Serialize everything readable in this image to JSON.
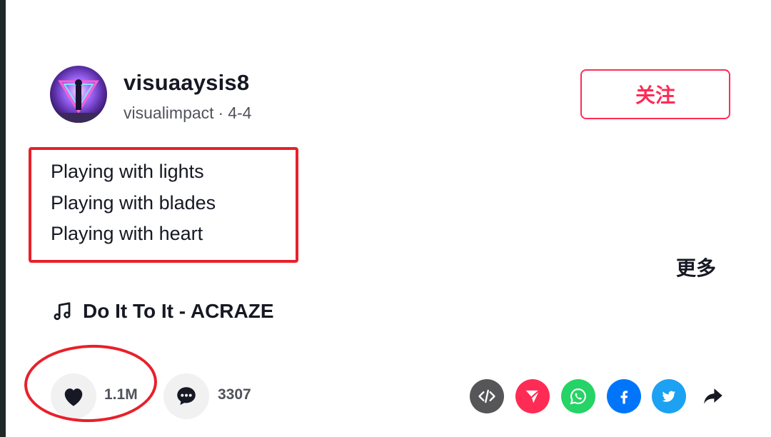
{
  "author": {
    "username": "visuaaysis8",
    "nickname": "visualimpact",
    "separator": "·",
    "date": "4-4"
  },
  "follow_label": "关注",
  "description": {
    "lines": [
      "Playing with lights",
      "Playing with blades",
      "Playing with heart"
    ]
  },
  "more_label": "更多",
  "music": {
    "icon": "music-note-icon",
    "title": "Do It To It - ACRAZE"
  },
  "stats": {
    "likes": "1.1M",
    "comments": "3307"
  },
  "share": {
    "items": [
      {
        "icon": "embed-icon",
        "color": "#565658"
      },
      {
        "icon": "send-icon",
        "color": "#fe2c55"
      },
      {
        "icon": "whatsapp-icon",
        "color": "#25d366"
      },
      {
        "icon": "facebook-icon",
        "color": "#0075fa"
      },
      {
        "icon": "twitter-icon",
        "color": "#1da1f2"
      },
      {
        "icon": "share-arrow-icon",
        "color": "#161823"
      }
    ]
  },
  "colors": {
    "accent": "#fe2c55",
    "annotation": "#e8202a"
  }
}
